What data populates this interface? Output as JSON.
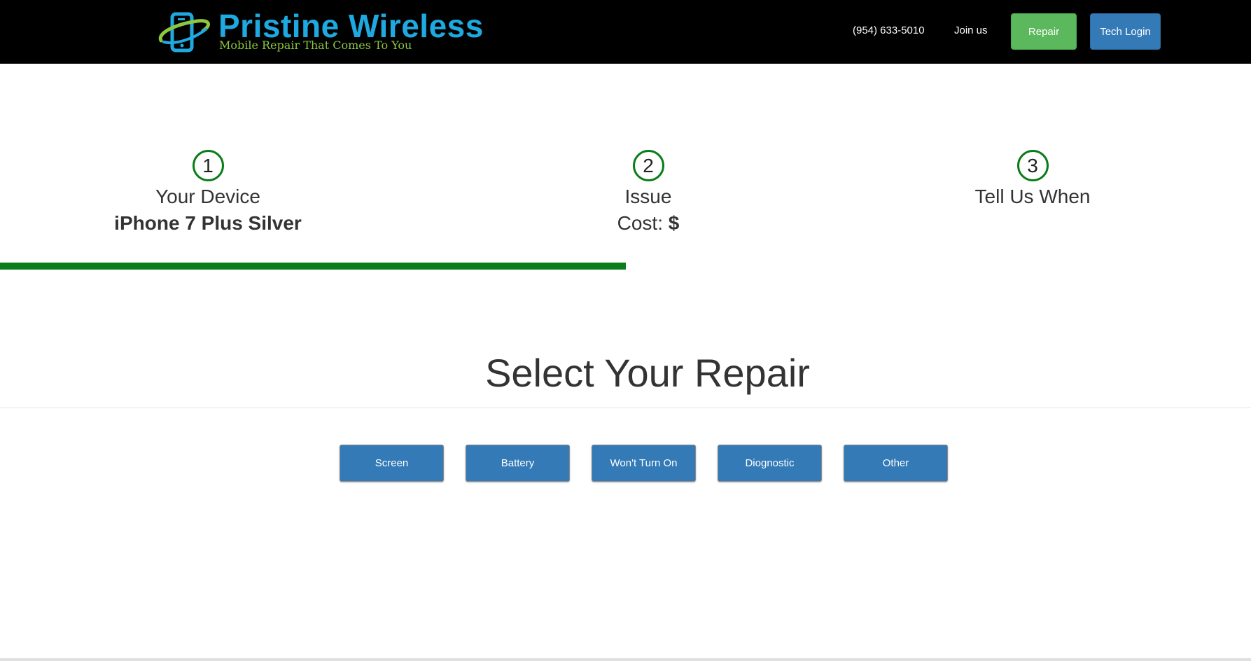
{
  "header": {
    "brand_name": "Pristine Wireless",
    "tagline": "Mobile Repair That Comes To You",
    "logo_icon": "phone-orbit-icon",
    "phone": "(954) 633-5010",
    "join_label": "Join us",
    "repair_label": "Repair",
    "tech_login_label": "Tech Login"
  },
  "steps": [
    {
      "number": "1",
      "title": "Your Device",
      "detail": "iPhone 7 Plus Silver"
    },
    {
      "number": "2",
      "title": "Issue",
      "detail_prefix": "Cost: ",
      "detail_value": "$"
    },
    {
      "number": "3",
      "title": "Tell Us When"
    }
  ],
  "progress": {
    "fraction": 0.5,
    "color": "#0a7d1a"
  },
  "main": {
    "title": "Select Your Repair",
    "repair_options": [
      "Screen",
      "Battery",
      "Won't Turn On",
      "Diognostic",
      "Other"
    ]
  },
  "colors": {
    "accent_blue": "#337ab7",
    "accent_green": "#5cb85c",
    "step_green": "#0a7d1a",
    "brand_blue": "#1fa9e1",
    "brand_green": "#8dc63f"
  }
}
